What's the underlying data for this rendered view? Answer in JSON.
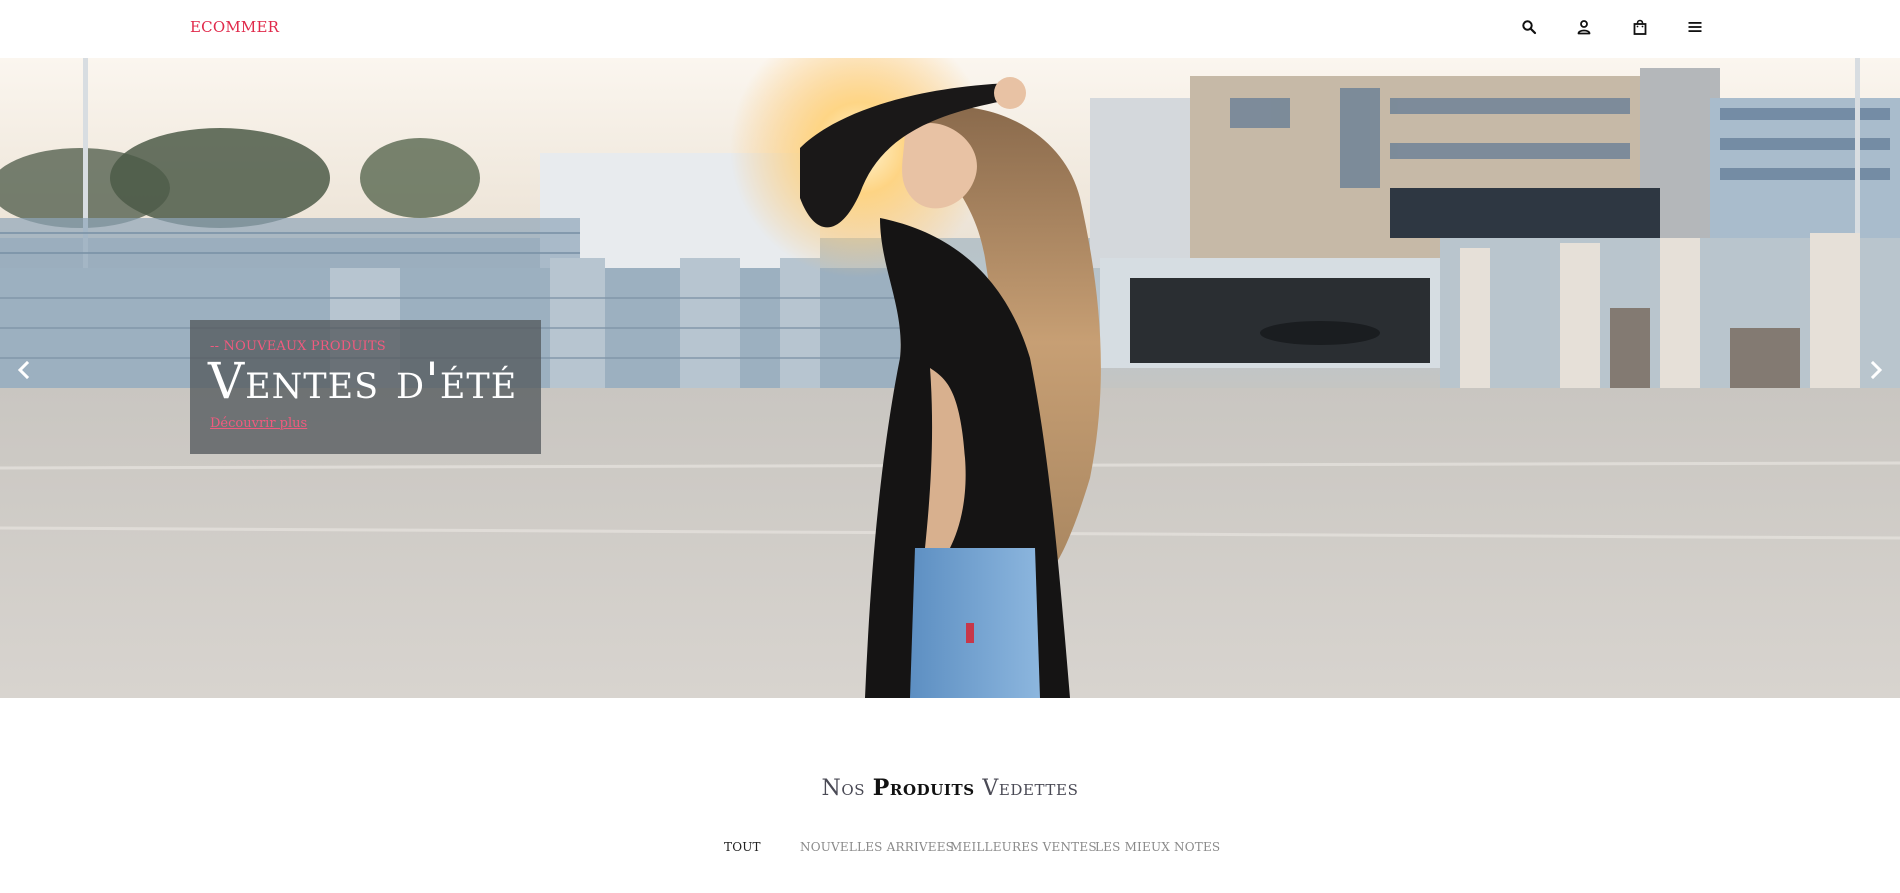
{
  "header": {
    "logo": "ECOMMER",
    "icons": [
      "search-icon",
      "user-icon",
      "bag-icon",
      "menu-icon"
    ]
  },
  "hero": {
    "eyebrow": "-- NOUVEAUX PRODUITS",
    "title": "Ventes d'été",
    "link_label": "Découvrir plus",
    "prev_icon": "chevron-left-icon",
    "next_icon": "chevron-right-icon"
  },
  "featured": {
    "title_prefix": "Nos ",
    "title_bold": "Produits",
    "title_suffix": " Vedettes",
    "tabs": [
      {
        "label": "TOUT",
        "active": true
      },
      {
        "label": "NOUVELLES ARRIVEES",
        "active": false
      },
      {
        "label": "MEILLEURES VENTES",
        "active": false
      },
      {
        "label": "LES MIEUX NOTES",
        "active": false
      }
    ]
  },
  "colors": {
    "accent": "#e0294a",
    "accent_light": "#f15a7e"
  }
}
